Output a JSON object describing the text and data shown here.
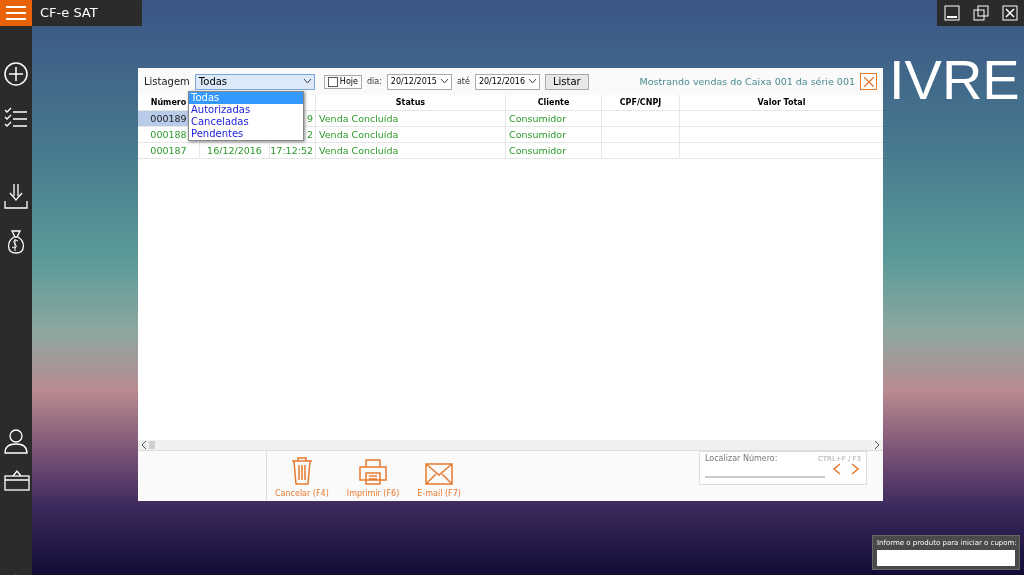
{
  "app": {
    "title": "CF-e SAT",
    "background_text": "IVRE"
  },
  "dialog": {
    "filter_label": "Listagem",
    "filter_value": "Todas",
    "filter_options": [
      {
        "label": "Todas",
        "selected": true
      },
      {
        "label": "Autorizadas",
        "selected": false
      },
      {
        "label": "Canceladas",
        "selected": false
      },
      {
        "label": "Pendentes",
        "selected": false
      }
    ],
    "today": {
      "label": "Hoje",
      "checked": false
    },
    "from_label": "dia:",
    "from": "20/12/2015",
    "to_label": "até",
    "to": "20/12/2016",
    "list_button": "Listar",
    "info": "Mostrando vendas do Caixa 001 da série 001",
    "columns": [
      "Número",
      "Status",
      "Cliente",
      "CPF/CNPJ",
      "Valor Total"
    ],
    "rows": [
      {
        "number": "000189",
        "time": "9",
        "status": "Venda Concluída",
        "client": "Consumidor",
        "selected": true
      },
      {
        "number": "000188",
        "time": "2",
        "status": "Venda Concluída",
        "client": "Consumidor",
        "selected": false
      },
      {
        "number": "000187",
        "date": "16/12/2016",
        "time": "17:12:52",
        "status": "Venda Concluída",
        "client": "Consumidor",
        "selected": false
      }
    ],
    "actions": [
      {
        "kind": "trash",
        "label": "Cancelar (F4)"
      },
      {
        "kind": "printer",
        "label": "Imprimir (F6)"
      },
      {
        "kind": "mail",
        "label": "E-mail (F7)"
      }
    ],
    "search": {
      "label": "Localizar Número:",
      "shortcut": "CTRL+F / F3"
    }
  },
  "coupon": {
    "label": "Informe o produto para iniciar o cupom:"
  }
}
